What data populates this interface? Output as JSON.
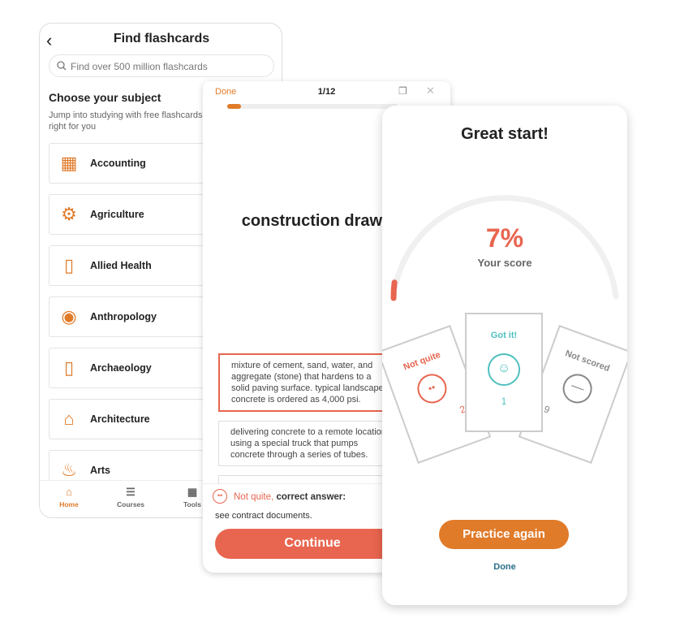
{
  "find": {
    "title": "Find flashcards",
    "search_placeholder": "Find over 500 million flashcards",
    "heading": "Choose your subject",
    "subtext": "Jump into studying with free flashcards right for you",
    "subjects": [
      {
        "label": "Accounting",
        "icon": "calculator-icon"
      },
      {
        "label": "Agriculture",
        "icon": "tractor-icon"
      },
      {
        "label": "Allied Health",
        "icon": "tablet-icon"
      },
      {
        "label": "Anthropology",
        "icon": "globe-icon"
      },
      {
        "label": "Archaeology",
        "icon": "tablet-icon"
      },
      {
        "label": "Architecture",
        "icon": "columns-icon"
      },
      {
        "label": "Arts",
        "icon": "palette-icon"
      }
    ],
    "nav": [
      {
        "label": "Home",
        "active": true
      },
      {
        "label": "Courses"
      },
      {
        "label": "Tools"
      }
    ]
  },
  "study": {
    "done": "Done",
    "counter": "1/12",
    "progress": 1,
    "progress_total": 12,
    "term": "construction drawings",
    "options": [
      "mixture of cement, sand, water, and aggregate (stone) that hardens to a solid paving surface. typical landscape concrete is ordered as 4,000 psi.",
      "delivering concrete to a remote location using a special truck that pumps concrete through a series of tubes."
    ],
    "feedback_status": "Not quite,",
    "feedback_label": "correct answer:",
    "correct_answer": "see contract documents.",
    "continue": "Continue"
  },
  "results": {
    "title": "Great start!",
    "score": "7%",
    "score_value": 7,
    "score_label": "Your score",
    "cards": [
      {
        "label": "Not quite",
        "count": "2"
      },
      {
        "label": "Got it!",
        "count": "1"
      },
      {
        "label": "Not scored",
        "count": "9"
      }
    ],
    "practice_again": "Practice again",
    "done": "Done"
  },
  "colors": {
    "orange": "#e07b2a",
    "red": "#e8654f",
    "teal": "#4fbfbf",
    "gray": "#888888",
    "link": "#2b6f8a"
  }
}
